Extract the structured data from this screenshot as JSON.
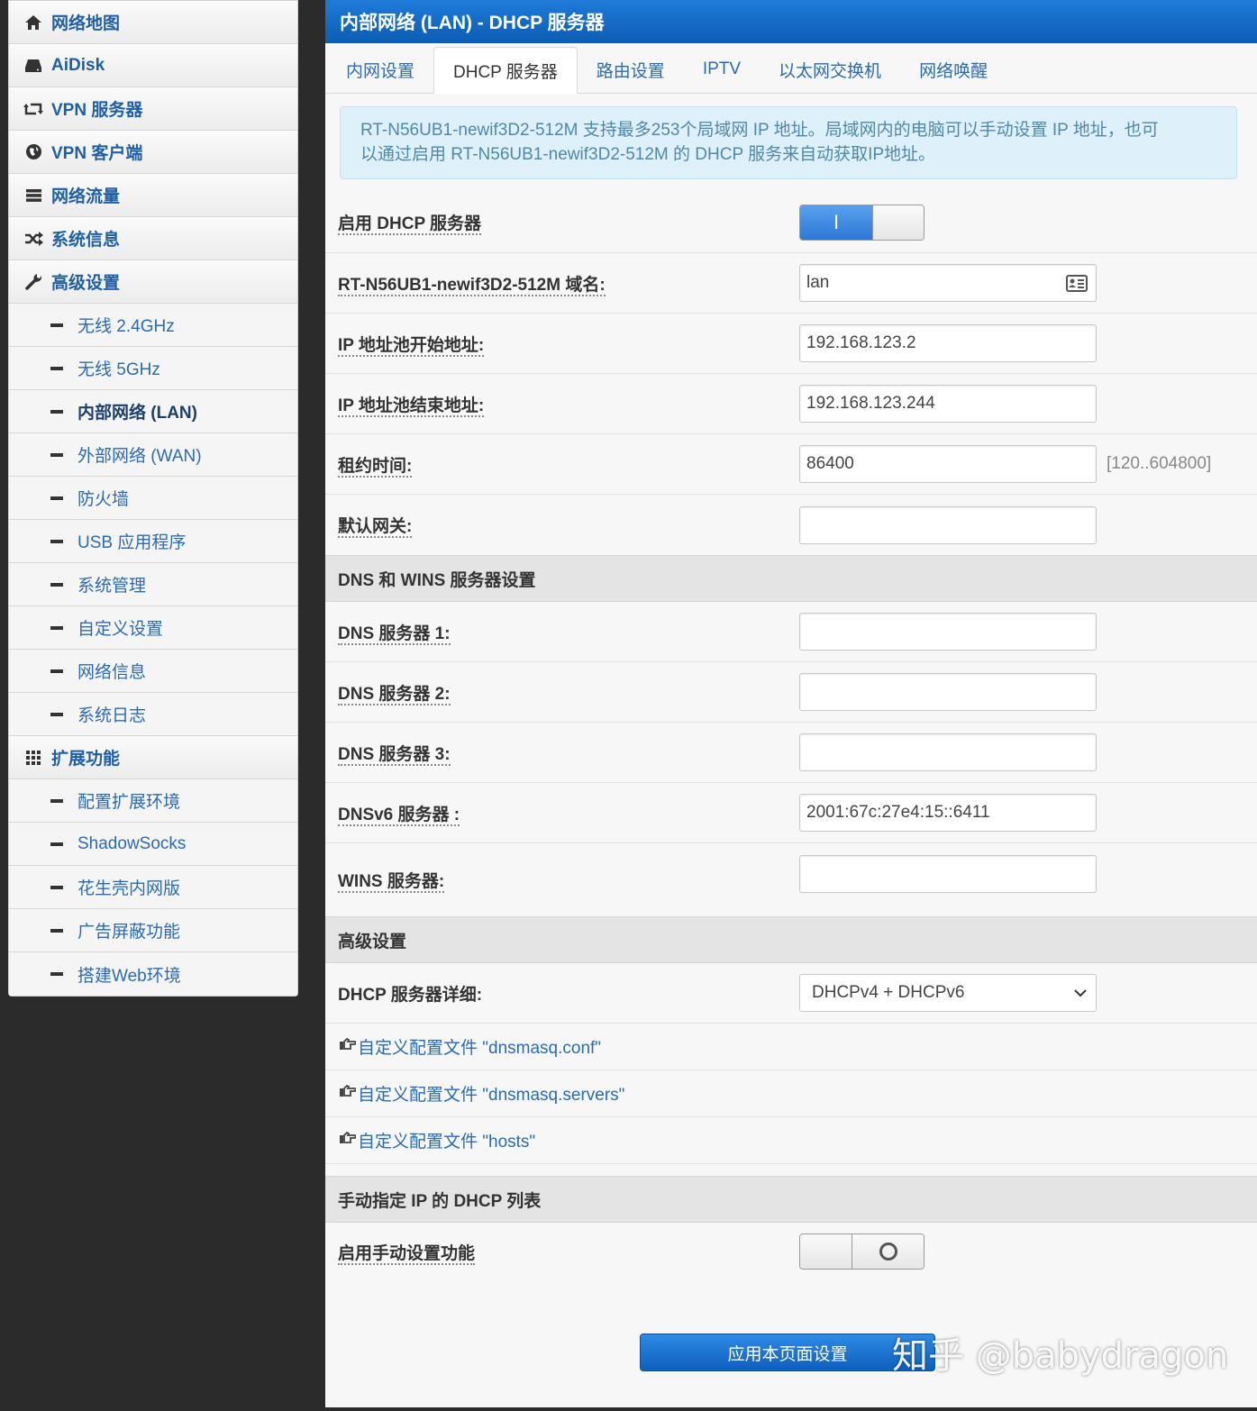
{
  "sidebar": {
    "items": [
      {
        "type": "top",
        "icon": "home-icon",
        "label": "网络地图"
      },
      {
        "type": "top",
        "icon": "hdd-icon",
        "label": "AiDisk"
      },
      {
        "type": "top",
        "icon": "retweet-icon",
        "label": "VPN 服务器"
      },
      {
        "type": "top",
        "icon": "globe-icon",
        "label": "VPN 客户端"
      },
      {
        "type": "top",
        "icon": "list-icon",
        "label": "网络流量"
      },
      {
        "type": "top",
        "icon": "random-icon",
        "label": "系统信息"
      },
      {
        "type": "top",
        "icon": "wrench-icon",
        "label": "高级设置"
      },
      {
        "type": "sub",
        "label": "无线 2.4GHz"
      },
      {
        "type": "sub",
        "label": "无线 5GHz"
      },
      {
        "type": "sub",
        "label": "内部网络 (LAN)",
        "active": true
      },
      {
        "type": "sub",
        "label": "外部网络 (WAN)"
      },
      {
        "type": "sub",
        "label": "防火墙"
      },
      {
        "type": "sub",
        "label": "USB 应用程序"
      },
      {
        "type": "sub",
        "label": "系统管理"
      },
      {
        "type": "sub",
        "label": "自定义设置"
      },
      {
        "type": "sub",
        "label": "网络信息"
      },
      {
        "type": "sub",
        "label": "系统日志"
      },
      {
        "type": "top",
        "icon": "grid-icon",
        "label": "扩展功能"
      },
      {
        "type": "sub",
        "label": "配置扩展环境"
      },
      {
        "type": "sub",
        "label": "ShadowSocks"
      },
      {
        "type": "sub",
        "label": "花生壳内网版"
      },
      {
        "type": "sub",
        "label": "广告屏蔽功能"
      },
      {
        "type": "sub",
        "label": "搭建Web环境"
      }
    ]
  },
  "main": {
    "title": "内部网络 (LAN) - DHCP 服务器",
    "tabs": [
      "内网设置",
      "DHCP 服务器",
      "路由设置",
      "IPTV",
      "以太网交换机",
      "网络唤醒"
    ],
    "active_tab": 1,
    "info_line1": "RT-N56UB1-newif3D2-512M 支持最多253个局域网 IP 地址。局域网内的电脑可以手动设置 IP 地址，也可",
    "info_line2": "以通过启用 RT-N56UB1-newif3D2-512M 的 DHCP 服务来自动获取IP地址。",
    "enable_dhcp": {
      "label": "启用 DHCP 服务器",
      "on_glyph": "I"
    },
    "domain": {
      "label": "RT-N56UB1-newif3D2-512M 域名:",
      "value": "lan"
    },
    "ip_start": {
      "label": "IP 地址池开始地址:",
      "value": "192.168.123.2"
    },
    "ip_end": {
      "label": "IP 地址池结束地址:",
      "value": "192.168.123.244"
    },
    "lease": {
      "label": "租约时间:",
      "value": "86400",
      "hint": "[120..604800]"
    },
    "gateway": {
      "label": "默认网关:",
      "value": ""
    },
    "dns_section": "DNS 和 WINS 服务器设置",
    "dns1": {
      "label": "DNS 服务器 1:",
      "value": ""
    },
    "dns2": {
      "label": "DNS 服务器 2:",
      "value": ""
    },
    "dns3": {
      "label": "DNS 服务器 3:",
      "value": ""
    },
    "dnsv6": {
      "label": "DNSv6 服务器 :",
      "value": "2001:67c:27e4:15::6411"
    },
    "wins": {
      "label": "WINS 服务器:",
      "value": ""
    },
    "adv_section": "高级设置",
    "dhcp_detail": {
      "label": "DHCP 服务器详细:",
      "value": "DHCPv4 + DHCPv6"
    },
    "links": [
      "自定义配置文件 \"dnsmasq.conf\"",
      "自定义配置文件 \"dnsmasq.servers\"",
      "自定义配置文件 \"hosts\""
    ],
    "manual_section": "手动指定 IP 的 DHCP 列表",
    "manual_enable": {
      "label": "启用手动设置功能"
    },
    "apply_label": "应用本页面设置"
  },
  "watermark": "知乎 @babydragon"
}
